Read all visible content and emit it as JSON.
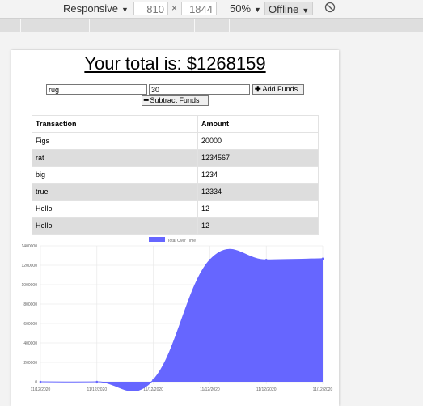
{
  "devtools": {
    "device_mode": "Responsive",
    "width_value": "810",
    "dim_separator": "×",
    "height_value": "1844",
    "zoom": "50%",
    "throttling": "Offline"
  },
  "page": {
    "total_text": "Your total is: $1268159",
    "name_input_value": "rug",
    "amount_input_value": "30",
    "add_funds_label": "Add Funds",
    "subtract_funds_label": "Subtract Funds",
    "table": {
      "headers": [
        "Transaction",
        "Amount"
      ],
      "rows": [
        {
          "name": "Figs",
          "amount": "20000"
        },
        {
          "name": "rat",
          "amount": "1234567"
        },
        {
          "name": "big",
          "amount": "1234"
        },
        {
          "name": "true",
          "amount": "12334"
        },
        {
          "name": "Hello",
          "amount": "12"
        },
        {
          "name": "Hello",
          "amount": "12"
        }
      ]
    }
  },
  "colors": {
    "series_fill": "#6666ff",
    "grid": "#e6e6e6",
    "axis_text": "#666666"
  },
  "chart_data": {
    "type": "area",
    "legend": "Total Over Time",
    "x": [
      "11/12/2020",
      "11/12/2020",
      "11/12/2020",
      "11/12/2020",
      "11/12/2020",
      "11/12/2020"
    ],
    "series": [
      {
        "name": "Total Over Time",
        "values": [
          0,
          0,
          20000,
          1254567,
          1255801,
          1268135
        ]
      }
    ],
    "ylim": [
      0,
      1400000
    ],
    "yticks": [
      0,
      200000,
      400000,
      600000,
      800000,
      1000000,
      1200000,
      1400000
    ],
    "ytick_labels": [
      "0",
      "200000",
      "400000",
      "600000",
      "800000",
      "1000000",
      "1200000",
      "1400000"
    ],
    "grid": true,
    "legend_position": "top"
  }
}
